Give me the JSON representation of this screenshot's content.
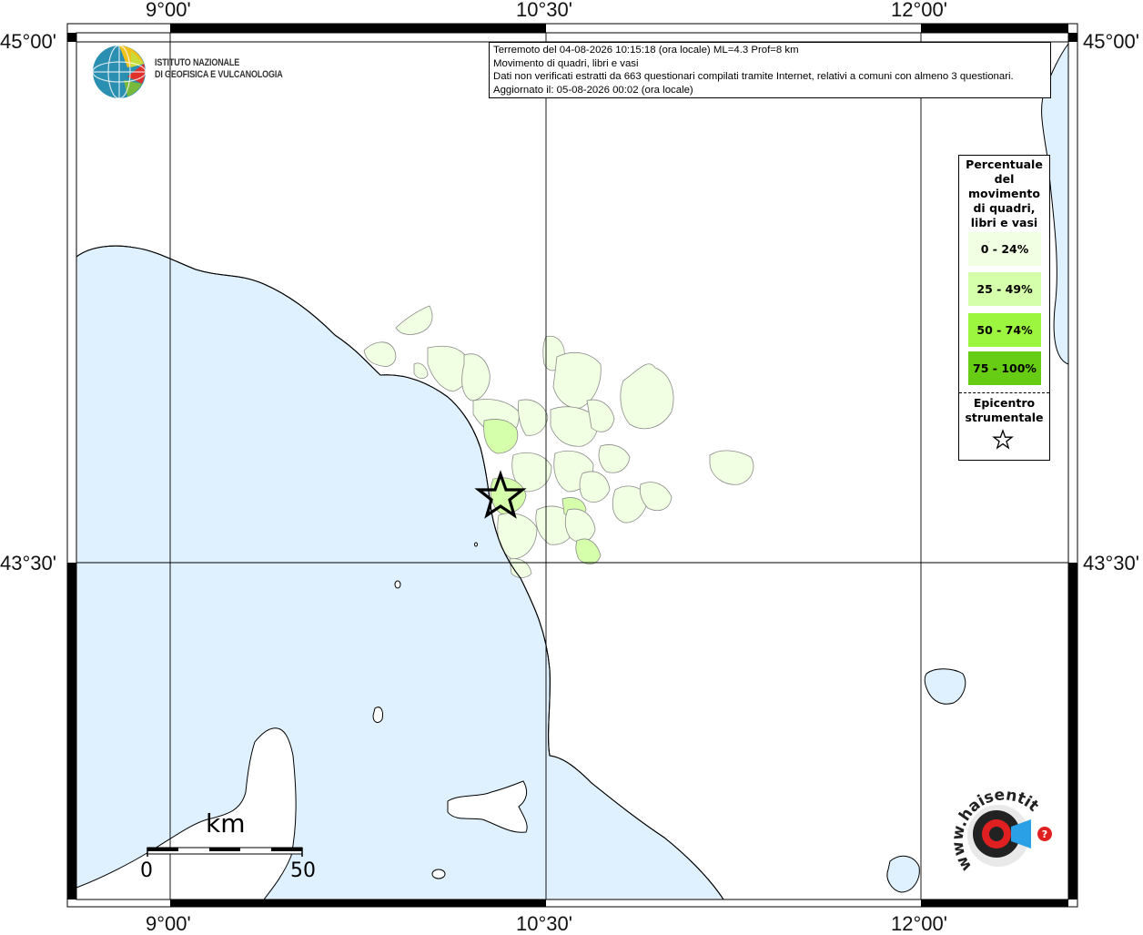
{
  "header": {
    "line1": "Terremoto del 04-08-2026 10:15:18 (ora locale) ML=4.3 Prof=8 km",
    "line2": "Movimento di quadri, libri e vasi",
    "line3": "Dati non verificati estratti da 663 questionari compilati tramite Internet, relativi a comuni con almeno 3 questionari.",
    "line4": "Aggiornato il: 05-08-2026 00:02 (ora locale)"
  },
  "logo": {
    "line1": "ISTITUTO NAZIONALE",
    "line2": "DI GEOFISICA E VULCANOLOGIA"
  },
  "axes": {
    "lon_labels": [
      "9°00'",
      "10°30'",
      "12°00'"
    ],
    "lat_labels": [
      "45°00'",
      "43°30'"
    ]
  },
  "legend": {
    "title_lines": [
      "Percentuale",
      "del",
      "movimento",
      "di quadri,",
      "libri e vasi"
    ],
    "classes": [
      {
        "label": "0 - 24%",
        "color": "#f1ffe3"
      },
      {
        "label": "25 - 49%",
        "color": "#d5ffaa"
      },
      {
        "label": "50 - 74%",
        "color": "#9cf53e"
      },
      {
        "label": "75 - 100%",
        "color": "#66cc14"
      }
    ],
    "epicenter_lines": [
      "Epicentro",
      "strumentale"
    ]
  },
  "scale_bar": {
    "unit": "km",
    "start": "0",
    "end": "50"
  },
  "badge": {
    "text": "www.haisentitoilterremoto.it"
  },
  "colors": {
    "sea": "#dff0ff",
    "land": "#ffffff",
    "epicenter_area": "#d5ffaa"
  }
}
